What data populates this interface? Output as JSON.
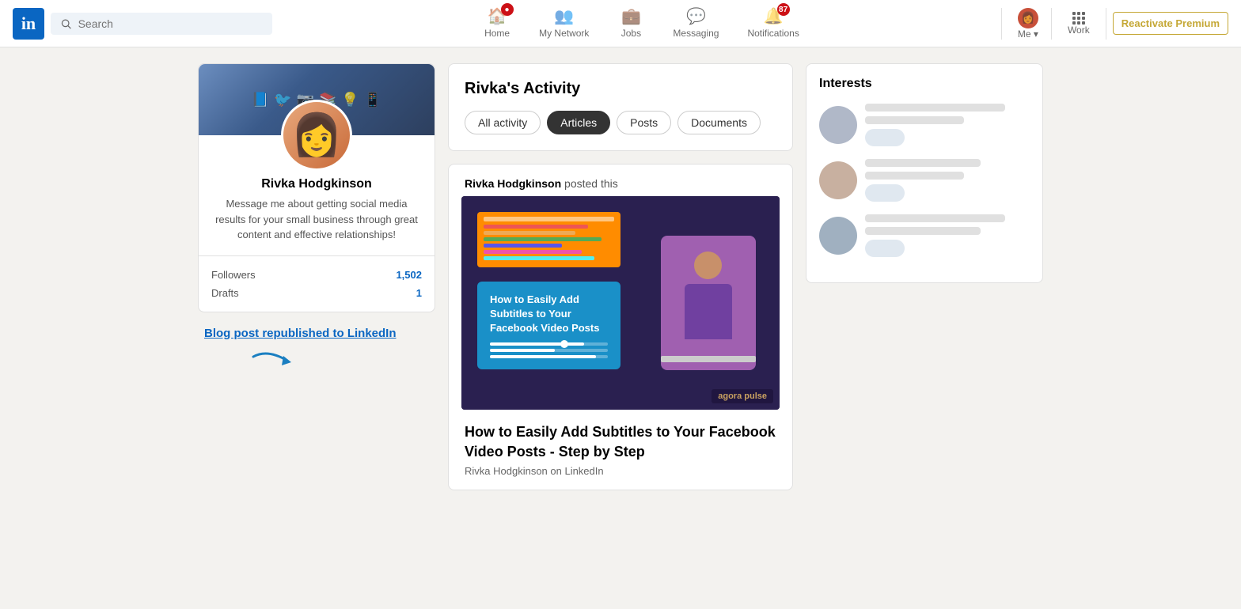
{
  "nav": {
    "logo_letter": "in",
    "search_placeholder": "Search",
    "items": [
      {
        "id": "home",
        "label": "Home",
        "icon": "🏠",
        "badge": null,
        "has_dot": true
      },
      {
        "id": "my-network",
        "label": "My Network",
        "icon": "👥",
        "badge": null
      },
      {
        "id": "jobs",
        "label": "Jobs",
        "icon": "💼",
        "badge": null
      },
      {
        "id": "messaging",
        "label": "Messaging",
        "icon": "💬",
        "badge": null
      },
      {
        "id": "notifications",
        "label": "Notifications",
        "icon": "🔔",
        "badge": "87"
      }
    ],
    "me_label": "Me",
    "work_label": "Work",
    "premium_label": "Reactivate Premium"
  },
  "profile": {
    "name": "Rivka Hodgkinson",
    "bio": "Message me about getting social media results for your small business through great content and effective relationships!",
    "followers_label": "Followers",
    "followers_count": "1,502",
    "drafts_label": "Drafts",
    "drafts_count": "1"
  },
  "blog_link": {
    "text": "Blog post republished to LinkedIn"
  },
  "activity": {
    "title": "Rivka's Activity",
    "filters": [
      {
        "id": "all",
        "label": "All activity",
        "active": false
      },
      {
        "id": "articles",
        "label": "Articles",
        "active": true
      },
      {
        "id": "posts",
        "label": "Posts",
        "active": false
      },
      {
        "id": "documents",
        "label": "Documents",
        "active": false
      }
    ]
  },
  "post": {
    "author": "Rivka Hodgkinson",
    "meta_suffix": "posted this",
    "image_alt": "How to Easily Add Subtitles to Your Facebook Video Posts article thumbnail",
    "overlay_title": "How to Easily Add Subtitles to Your Facebook Video Posts",
    "agora_brand": "agora pulse",
    "title": "How to Easily Add Subtitles to Your Facebook Video Posts - Step by Step",
    "subtitle": "Rivka Hodgkinson on LinkedIn"
  },
  "interests": {
    "title": "Interests",
    "items": [
      {
        "id": 1
      },
      {
        "id": 2
      },
      {
        "id": 3
      }
    ]
  }
}
